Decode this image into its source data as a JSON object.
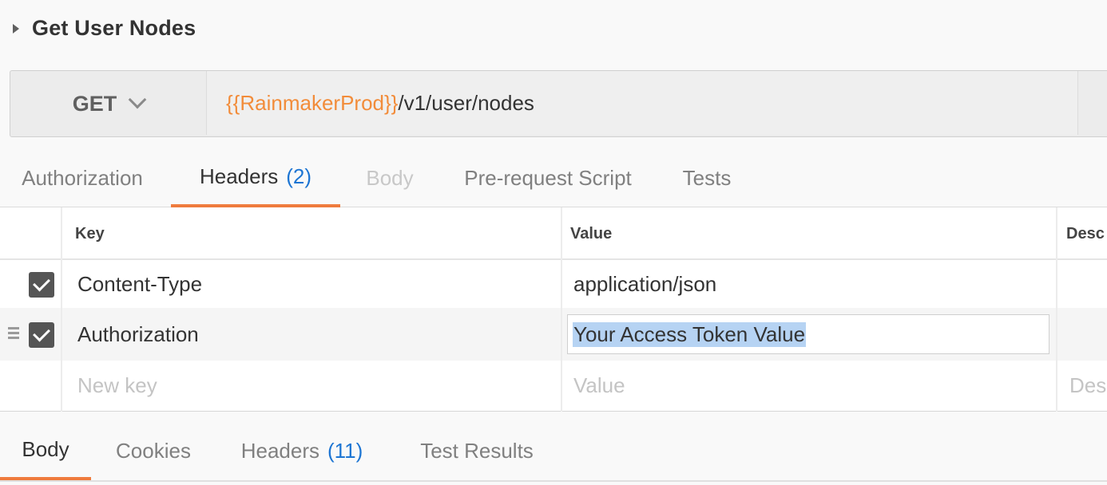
{
  "request": {
    "title": "Get User Nodes"
  },
  "url_bar": {
    "method": "GET",
    "url_variable": "{{RainmakerProd}}",
    "url_path": "/v1/user/nodes"
  },
  "request_tabs": [
    {
      "label": "Authorization",
      "count": "",
      "state": "normal"
    },
    {
      "label": "Headers",
      "count": "(2)",
      "state": "active"
    },
    {
      "label": "Body",
      "count": "",
      "state": "disabled"
    },
    {
      "label": "Pre-request Script",
      "count": "",
      "state": "normal"
    },
    {
      "label": "Tests",
      "count": "",
      "state": "normal"
    }
  ],
  "headers_table": {
    "columns": [
      "Key",
      "Value",
      "Desc"
    ],
    "rows": [
      {
        "checked": true,
        "key": "Content-Type",
        "value": "application/json"
      },
      {
        "checked": true,
        "key": "Authorization",
        "value": "Your Access Token Value",
        "selected": true
      }
    ],
    "new_row": {
      "key_placeholder": "New key",
      "value_placeholder": "Value",
      "desc_placeholder": "Desc"
    }
  },
  "response_tabs": [
    {
      "label": "Body",
      "count": "",
      "state": "active"
    },
    {
      "label": "Cookies",
      "count": "",
      "state": "normal"
    },
    {
      "label": "Headers",
      "count": "(11)",
      "state": "normal"
    },
    {
      "label": "Test Results",
      "count": "",
      "state": "normal"
    }
  ],
  "colors": {
    "accent_orange": "#ef7b3d",
    "variable_orange": "#f28c3a",
    "count_blue": "#1d75d3",
    "selection_blue": "#b6d3f3"
  }
}
